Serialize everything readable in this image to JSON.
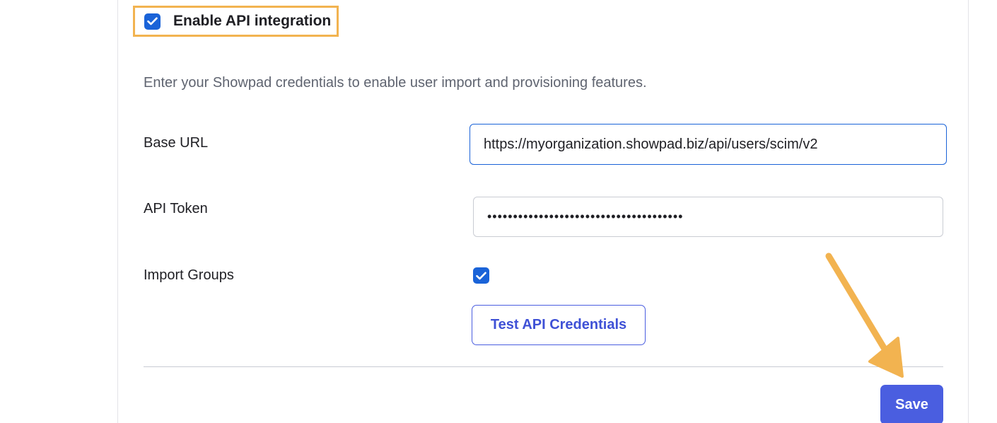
{
  "api_integration": {
    "enable_label": "Enable API integration",
    "enabled": true,
    "description": "Enter your Showpad credentials to enable user import and provisioning features."
  },
  "fields": {
    "base_url": {
      "label": "Base URL",
      "value": "https://myorganization.showpad.biz/api/users/scim/v2"
    },
    "api_token": {
      "label": "API Token",
      "value": "••••••••••••••••••••••••••••••••••••••"
    },
    "import_groups": {
      "label": "Import Groups",
      "checked": true
    }
  },
  "buttons": {
    "test_label": "Test API Credentials",
    "save_label": "Save"
  },
  "colors": {
    "checkbox": "#1a63d8",
    "highlight": "#f2b350",
    "primary": "#4a5ee0",
    "arrow": "#f2b350"
  },
  "icons": {
    "checkmark": "check-icon",
    "annotation": "arrow-annotation"
  }
}
